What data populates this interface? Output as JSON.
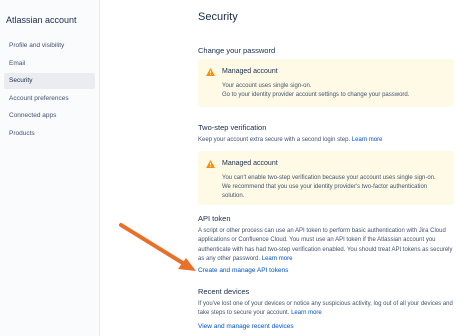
{
  "sidebar": {
    "brand": "Atlassian account",
    "items": [
      {
        "label": "Profile and visibility"
      },
      {
        "label": "Email"
      },
      {
        "label": "Security"
      },
      {
        "label": "Account preferences"
      },
      {
        "label": "Connected apps"
      },
      {
        "label": "Products"
      }
    ],
    "active_index": 2
  },
  "page": {
    "title": "Security"
  },
  "change_password": {
    "title": "Change your password",
    "notice": {
      "icon": "warning-icon",
      "title": "Managed account",
      "line1": "Your account uses single sign-on.",
      "line2": "Go to your identity provider account settings to change your password."
    }
  },
  "two_step": {
    "title": "Two-step verification",
    "description": "Keep your account extra secure with a second login step.",
    "learn_more": "Learn more",
    "notice": {
      "icon": "warning-icon",
      "title": "Managed account",
      "body": "You can't enable two-step verification because your account uses single sign-on. We recommend that you use your identity provider's two-factor authentication solution."
    }
  },
  "api_token": {
    "title": "API token",
    "description": "A script or other process can use an API token to perform basic authentication with Jira Cloud applications or Confluence Cloud. You must use an API token if the Atlassian account you authenticate with has had two-step verification enabled. You should treat API tokens as securely as any other password.",
    "learn_more": "Learn more",
    "manage_link": "Create and manage API tokens"
  },
  "recent_devices": {
    "title": "Recent devices",
    "description": "If you've lost one of your devices or notice any suspicious activity, log out of all your devices and take steps to secure your account.",
    "learn_more": "Learn more",
    "manage_link": "View and manage recent devices"
  },
  "colors": {
    "warning": "#ff8b00",
    "link": "#0052cc",
    "arrow": "#e8702a",
    "notice_bg": "#fffae6"
  }
}
